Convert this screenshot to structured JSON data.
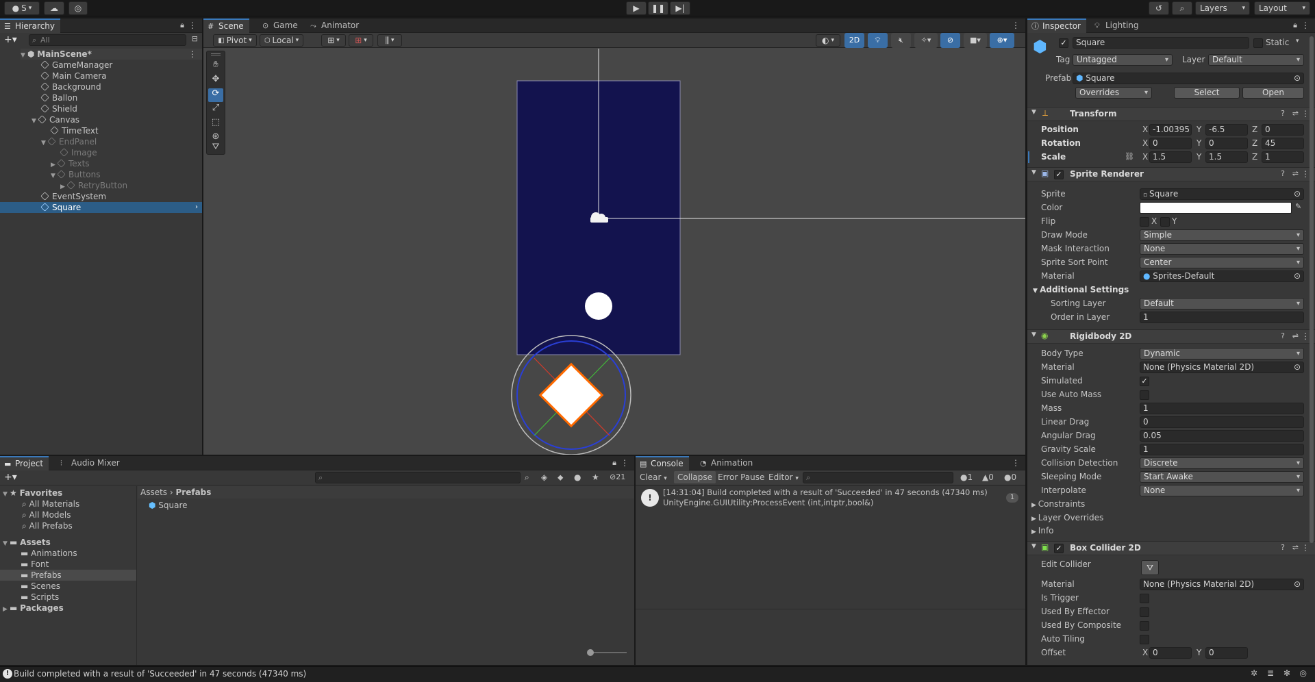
{
  "toolbar": {
    "account": "S",
    "layers": "Layers",
    "layout": "Layout"
  },
  "hierarchy": {
    "tab": "Hierarchy",
    "search_placeholder": "All",
    "scene": "MainScene*",
    "items": [
      "GameManager",
      "Main Camera",
      "Background",
      "Ballon",
      "Shield",
      "Canvas",
      "TimeText",
      "EndPanel",
      "Image",
      "Texts",
      "Buttons",
      "RetryButton",
      "EventSystem",
      "Square"
    ]
  },
  "scene_view": {
    "tabs": [
      "Scene",
      "Game",
      "Animator"
    ],
    "pivot": "Pivot",
    "local": "Local",
    "mode_2d": "2D",
    "colors": {
      "background_sprite": "#13134e",
      "viewport": "#474747",
      "selection": "#ff6a00"
    }
  },
  "project": {
    "tabs": [
      "Project",
      "Audio Mixer"
    ],
    "favorites_label": "Favorites",
    "favorites": [
      "All Materials",
      "All Models",
      "All Prefabs"
    ],
    "assets_label": "Assets",
    "folders": [
      "Animations",
      "Font",
      "Prefabs",
      "Scenes",
      "Scripts"
    ],
    "packages_label": "Packages",
    "breadcrumb": [
      "Assets",
      "Prefabs"
    ],
    "files": [
      "Square"
    ],
    "hidden_count": "21"
  },
  "console": {
    "tabs": [
      "Console",
      "Animation"
    ],
    "buttons": [
      "Clear",
      "Collapse",
      "Error Pause",
      "Editor"
    ],
    "counts": {
      "log": "1",
      "warn": "0",
      "error": "0"
    },
    "message_line1": "[14:31:04] Build completed with a result of 'Succeeded' in 47 seconds (47340 ms)",
    "message_line2": "UnityEngine.GUIUtility:ProcessEvent (int,intptr,bool&)",
    "message_count": "1"
  },
  "inspector": {
    "tabs": [
      "Inspector",
      "Lighting"
    ],
    "name": "Square",
    "static": "Static",
    "tag_label": "Tag",
    "tag": "Untagged",
    "layer_label": "Layer",
    "layer": "Default",
    "prefab_label": "Prefab",
    "prefab": "Square",
    "overrides": "Overrides",
    "select": "Select",
    "open": "Open",
    "transform": {
      "title": "Transform",
      "position_label": "Position",
      "position": {
        "x": "-1.00395",
        "y": "-6.5",
        "z": "0"
      },
      "rotation_label": "Rotation",
      "rotation": {
        "x": "0",
        "y": "0",
        "z": "45"
      },
      "scale_label": "Scale",
      "scale": {
        "x": "1.5",
        "y": "1.5",
        "z": "1"
      }
    },
    "sprite_renderer": {
      "title": "Sprite Renderer",
      "rows": [
        {
          "label": "Sprite",
          "value": "Square"
        },
        {
          "label": "Color",
          "value": ""
        },
        {
          "label": "Flip",
          "value": ""
        },
        {
          "label": "Draw Mode",
          "value": "Simple"
        },
        {
          "label": "Mask Interaction",
          "value": "None"
        },
        {
          "label": "Sprite Sort Point",
          "value": "Center"
        },
        {
          "label": "Material",
          "value": "Sprites-Default"
        }
      ],
      "additional": "Additional Settings",
      "sorting_layer_label": "Sorting Layer",
      "sorting_layer": "Default",
      "order_label": "Order in Layer",
      "order": "1",
      "flip_x": "X",
      "flip_y": "Y"
    },
    "rigidbody": {
      "title": "Rigidbody 2D",
      "rows": [
        {
          "label": "Body Type",
          "value": "Dynamic"
        },
        {
          "label": "Material",
          "value": "None (Physics Material 2D)"
        },
        {
          "label": "Simulated",
          "value": ""
        },
        {
          "label": "Use Auto Mass",
          "value": ""
        },
        {
          "label": "Mass",
          "value": "1"
        },
        {
          "label": "Linear Drag",
          "value": "0"
        },
        {
          "label": "Angular Drag",
          "value": "0.05"
        },
        {
          "label": "Gravity Scale",
          "value": "1"
        },
        {
          "label": "Collision Detection",
          "value": "Discrete"
        },
        {
          "label": "Sleeping Mode",
          "value": "Start Awake"
        },
        {
          "label": "Interpolate",
          "value": "None"
        }
      ],
      "constraints": "Constraints",
      "layer_overrides": "Layer Overrides",
      "info": "Info"
    },
    "box_collider": {
      "title": "Box Collider 2D",
      "rows": [
        {
          "label": "Edit Collider",
          "value": ""
        },
        {
          "label": "Material",
          "value": "None (Physics Material 2D)"
        },
        {
          "label": "Is Trigger",
          "value": ""
        },
        {
          "label": "Used By Effector",
          "value": ""
        },
        {
          "label": "Used By Composite",
          "value": ""
        },
        {
          "label": "Auto Tiling",
          "value": ""
        },
        {
          "label": "Offset",
          "value": ""
        }
      ],
      "offset": {
        "x": "0",
        "y": "0"
      }
    },
    "axis": {
      "x": "X",
      "y": "Y",
      "z": "Z"
    }
  },
  "status_bar": {
    "message": "Build completed with a result of 'Succeeded' in 47 seconds (47340 ms)"
  }
}
